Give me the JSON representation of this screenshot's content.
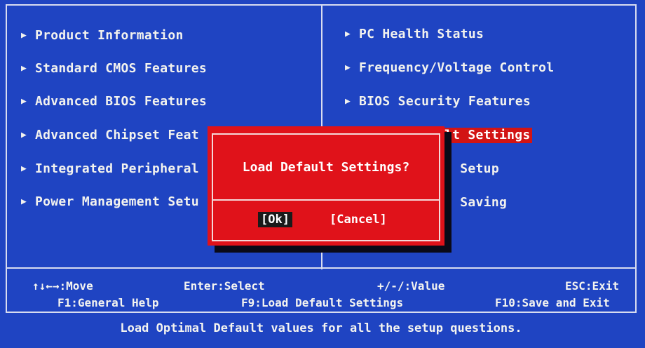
{
  "left_menu": [
    {
      "label": "Product Information"
    },
    {
      "label": "Standard CMOS Features"
    },
    {
      "label": "Advanced BIOS Features"
    },
    {
      "label": "Advanced Chipset Feat"
    },
    {
      "label": "Integrated Peripheral"
    },
    {
      "label": "Power Management Setu"
    }
  ],
  "right_menu": [
    {
      "label": "PC Health Status"
    },
    {
      "label": "Frequency/Voltage Control"
    },
    {
      "label": "BIOS Security Features"
    },
    {
      "label": "lt Settings"
    },
    {
      "label": "t Setup"
    },
    {
      "label": "t Saving"
    }
  ],
  "dialog": {
    "question": "Load Default Settings?",
    "ok_label": "[Ok]",
    "cancel_label": "[Cancel]"
  },
  "footer": {
    "move": "↑↓←→:Move",
    "select": "Enter:Select",
    "value": "+/-/:Value",
    "exit": "ESC:Exit",
    "help": "F1:General Help",
    "defaults": "F9:Load Default Settings",
    "save_exit": "F10:Save and Exit"
  },
  "status": "Load Optimal Default values for all the setup questions.",
  "colors": {
    "background": "#1f44c2",
    "dialog": "#e0121a",
    "highlight": "#d21414",
    "text": "#f2f2ee"
  }
}
